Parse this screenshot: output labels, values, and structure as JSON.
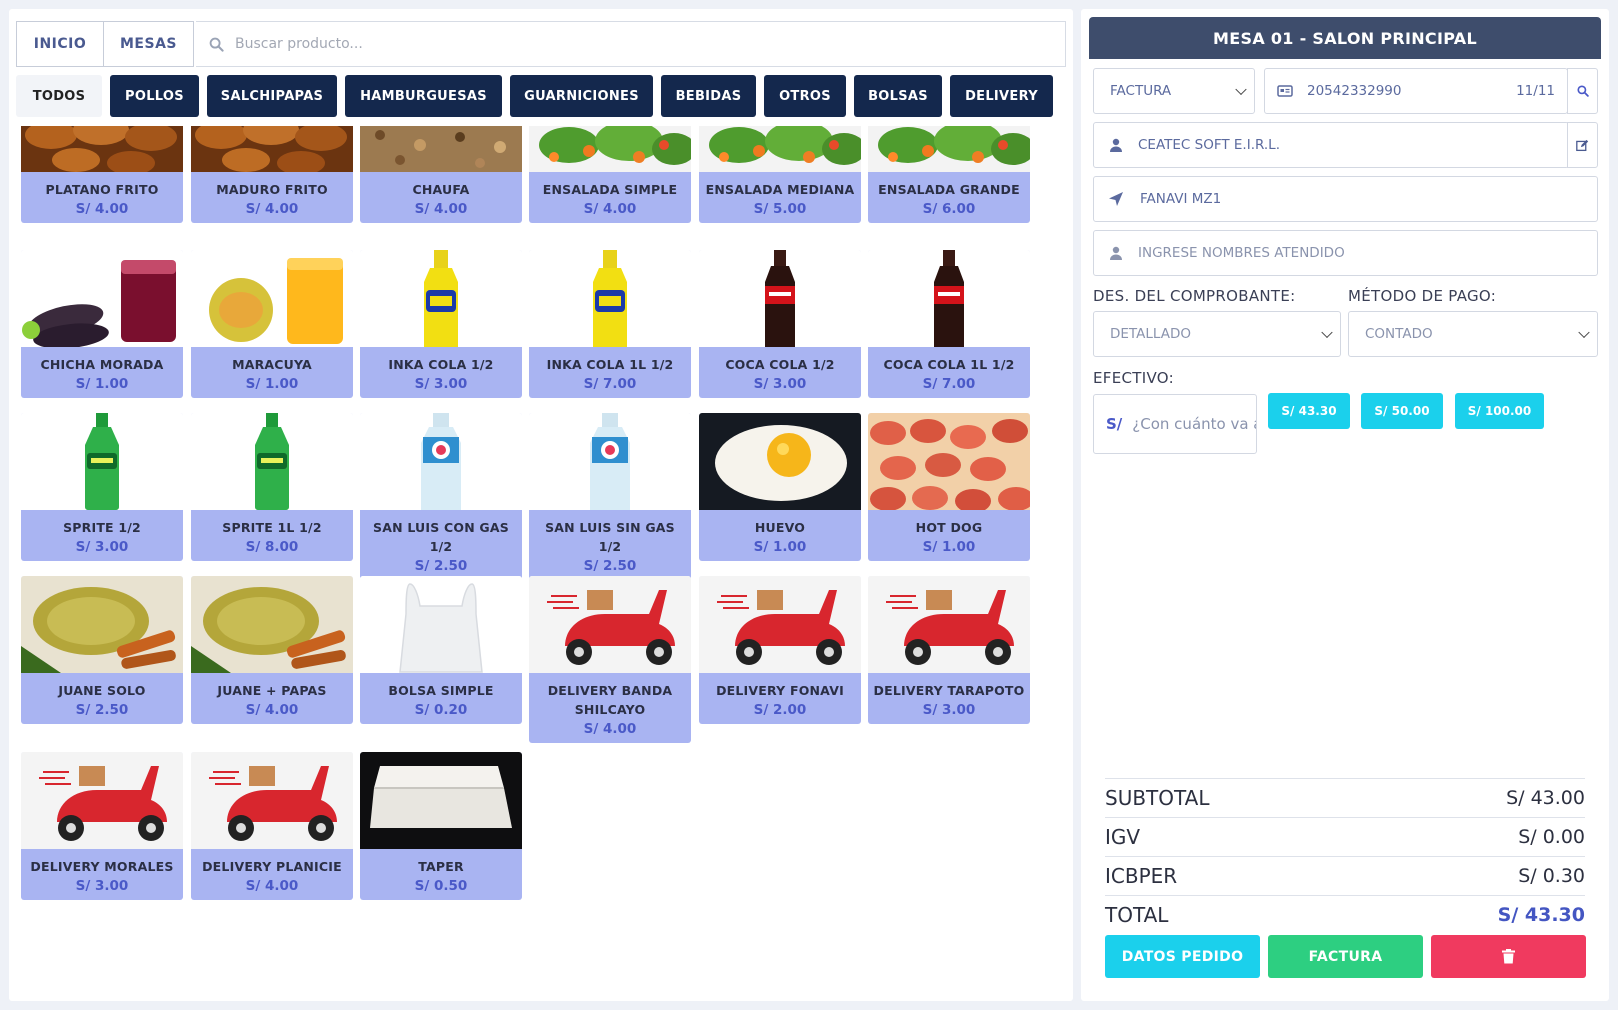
{
  "nav": {
    "inicio": "INICIO",
    "mesas": "MESAS",
    "search_placeholder": "Buscar producto..."
  },
  "categories": [
    "TODOS",
    "POLLOS",
    "SALCHIPAPAS",
    "HAMBURGUESAS",
    "GUARNICIONES",
    "BEBIDAS",
    "OTROS",
    "BOLSAS",
    "DELIVERY"
  ],
  "products": [
    {
      "name": "PLATANO FRITO",
      "price": "S/ 4.00",
      "icon": "fried-plantain-image"
    },
    {
      "name": "MADURO FRITO",
      "price": "S/ 4.00",
      "icon": "fried-plantain-image"
    },
    {
      "name": "CHAUFA",
      "price": "S/ 4.00",
      "icon": "fried-rice-image"
    },
    {
      "name": "ENSALADA SIMPLE",
      "price": "S/ 4.00",
      "icon": "salad-image"
    },
    {
      "name": "ENSALADA MEDIANA",
      "price": "S/ 5.00",
      "icon": "salad-image"
    },
    {
      "name": "ENSALADA GRANDE",
      "price": "S/ 6.00",
      "icon": "salad-image"
    },
    {
      "name": "CHICHA MORADA",
      "price": "S/ 1.00",
      "icon": "chicha-morada-image"
    },
    {
      "name": "MARACUYA",
      "price": "S/ 1.00",
      "icon": "passion-fruit-juice-image"
    },
    {
      "name": "INKA COLA 1/2",
      "price": "S/ 3.00",
      "icon": "inka-cola-bottle-image"
    },
    {
      "name": "INKA COLA 1L 1/2",
      "price": "S/ 7.00",
      "icon": "inka-cola-bottle-image"
    },
    {
      "name": "COCA COLA 1/2",
      "price": "S/ 3.00",
      "icon": "coca-cola-bottle-image"
    },
    {
      "name": "COCA COLA 1L 1/2",
      "price": "S/ 7.00",
      "icon": "coca-cola-bottle-image"
    },
    {
      "name": "SPRITE 1/2",
      "price": "S/ 3.00",
      "icon": "sprite-bottle-image"
    },
    {
      "name": "SPRITE 1L 1/2",
      "price": "S/ 8.00",
      "icon": "sprite-bottle-image"
    },
    {
      "name": "SAN LUIS CON GAS 1/2",
      "price": "S/ 2.50",
      "icon": "water-bottle-image"
    },
    {
      "name": "SAN LUIS SIN GAS 1/2",
      "price": "S/ 2.50",
      "icon": "water-bottle-image"
    },
    {
      "name": "HUEVO",
      "price": "S/ 1.00",
      "icon": "fried-egg-image"
    },
    {
      "name": "HOT DOG",
      "price": "S/ 1.00",
      "icon": "hot-dog-slices-image"
    },
    {
      "name": "JUANE SOLO",
      "price": "S/ 2.50",
      "icon": "juane-image"
    },
    {
      "name": "JUANE + PAPAS",
      "price": "S/ 4.00",
      "icon": "juane-image"
    },
    {
      "name": "BOLSA SIMPLE",
      "price": "S/ 0.20",
      "icon": "plastic-bag-image"
    },
    {
      "name": "DELIVERY BANDA SHILCAYO",
      "price": "S/ 4.00",
      "icon": "delivery-scooter-image"
    },
    {
      "name": "DELIVERY FONAVI",
      "price": "S/ 2.00",
      "icon": "delivery-scooter-image"
    },
    {
      "name": "DELIVERY TARAPOTO",
      "price": "S/ 3.00",
      "icon": "delivery-scooter-image"
    },
    {
      "name": "DELIVERY MORALES",
      "price": "S/ 3.00",
      "icon": "delivery-scooter-image"
    },
    {
      "name": "DELIVERY PLANICIE",
      "price": "S/ 4.00",
      "icon": "delivery-scooter-image"
    },
    {
      "name": "TAPER",
      "price": "S/ 0.50",
      "icon": "food-container-image"
    }
  ],
  "order": {
    "title": "MESA 01 - SALON PRINCIPAL",
    "doc_type": "FACTURA",
    "doc_number": "20542332990",
    "doc_count": "11/11",
    "client": "CEATEC SOFT E.I.R.L.",
    "address": "FANAVI MZ1",
    "attended_placeholder": "INGRESE NOMBRES ATENDIDO",
    "desc_label": "DES. DEL COMPROBANTE:",
    "desc_value": "DETALLADO",
    "payment_label": "MÉTODO DE PAGO:",
    "payment_value": "CONTADO",
    "cash_label": "EFECTIVO:",
    "cash_prefix": "S/",
    "cash_placeholder": "¿Con cuánto va a pagar?",
    "quick_amounts": [
      "S/ 43.30",
      "S/ 50.00",
      "S/ 100.00"
    ]
  },
  "totals": {
    "subtotal_label": "SUBTOTAL",
    "subtotal": "S/ 43.00",
    "igv_label": "IGV",
    "igv": "S/ 0.00",
    "icbper_label": "ICBPER",
    "icbper": "S/ 0.30",
    "total_label": "TOTAL",
    "total": "S/ 43.30"
  },
  "actions": {
    "details": "DATOS PEDIDO",
    "invoice": "FACTURA"
  },
  "colors": {
    "navy": "#14284d",
    "card": "#a9b4f2",
    "price": "#4a59c8",
    "cyan": "#1bd0ec",
    "green": "#2dcf81",
    "red": "#f03a5f",
    "header": "#3e4d6c"
  }
}
